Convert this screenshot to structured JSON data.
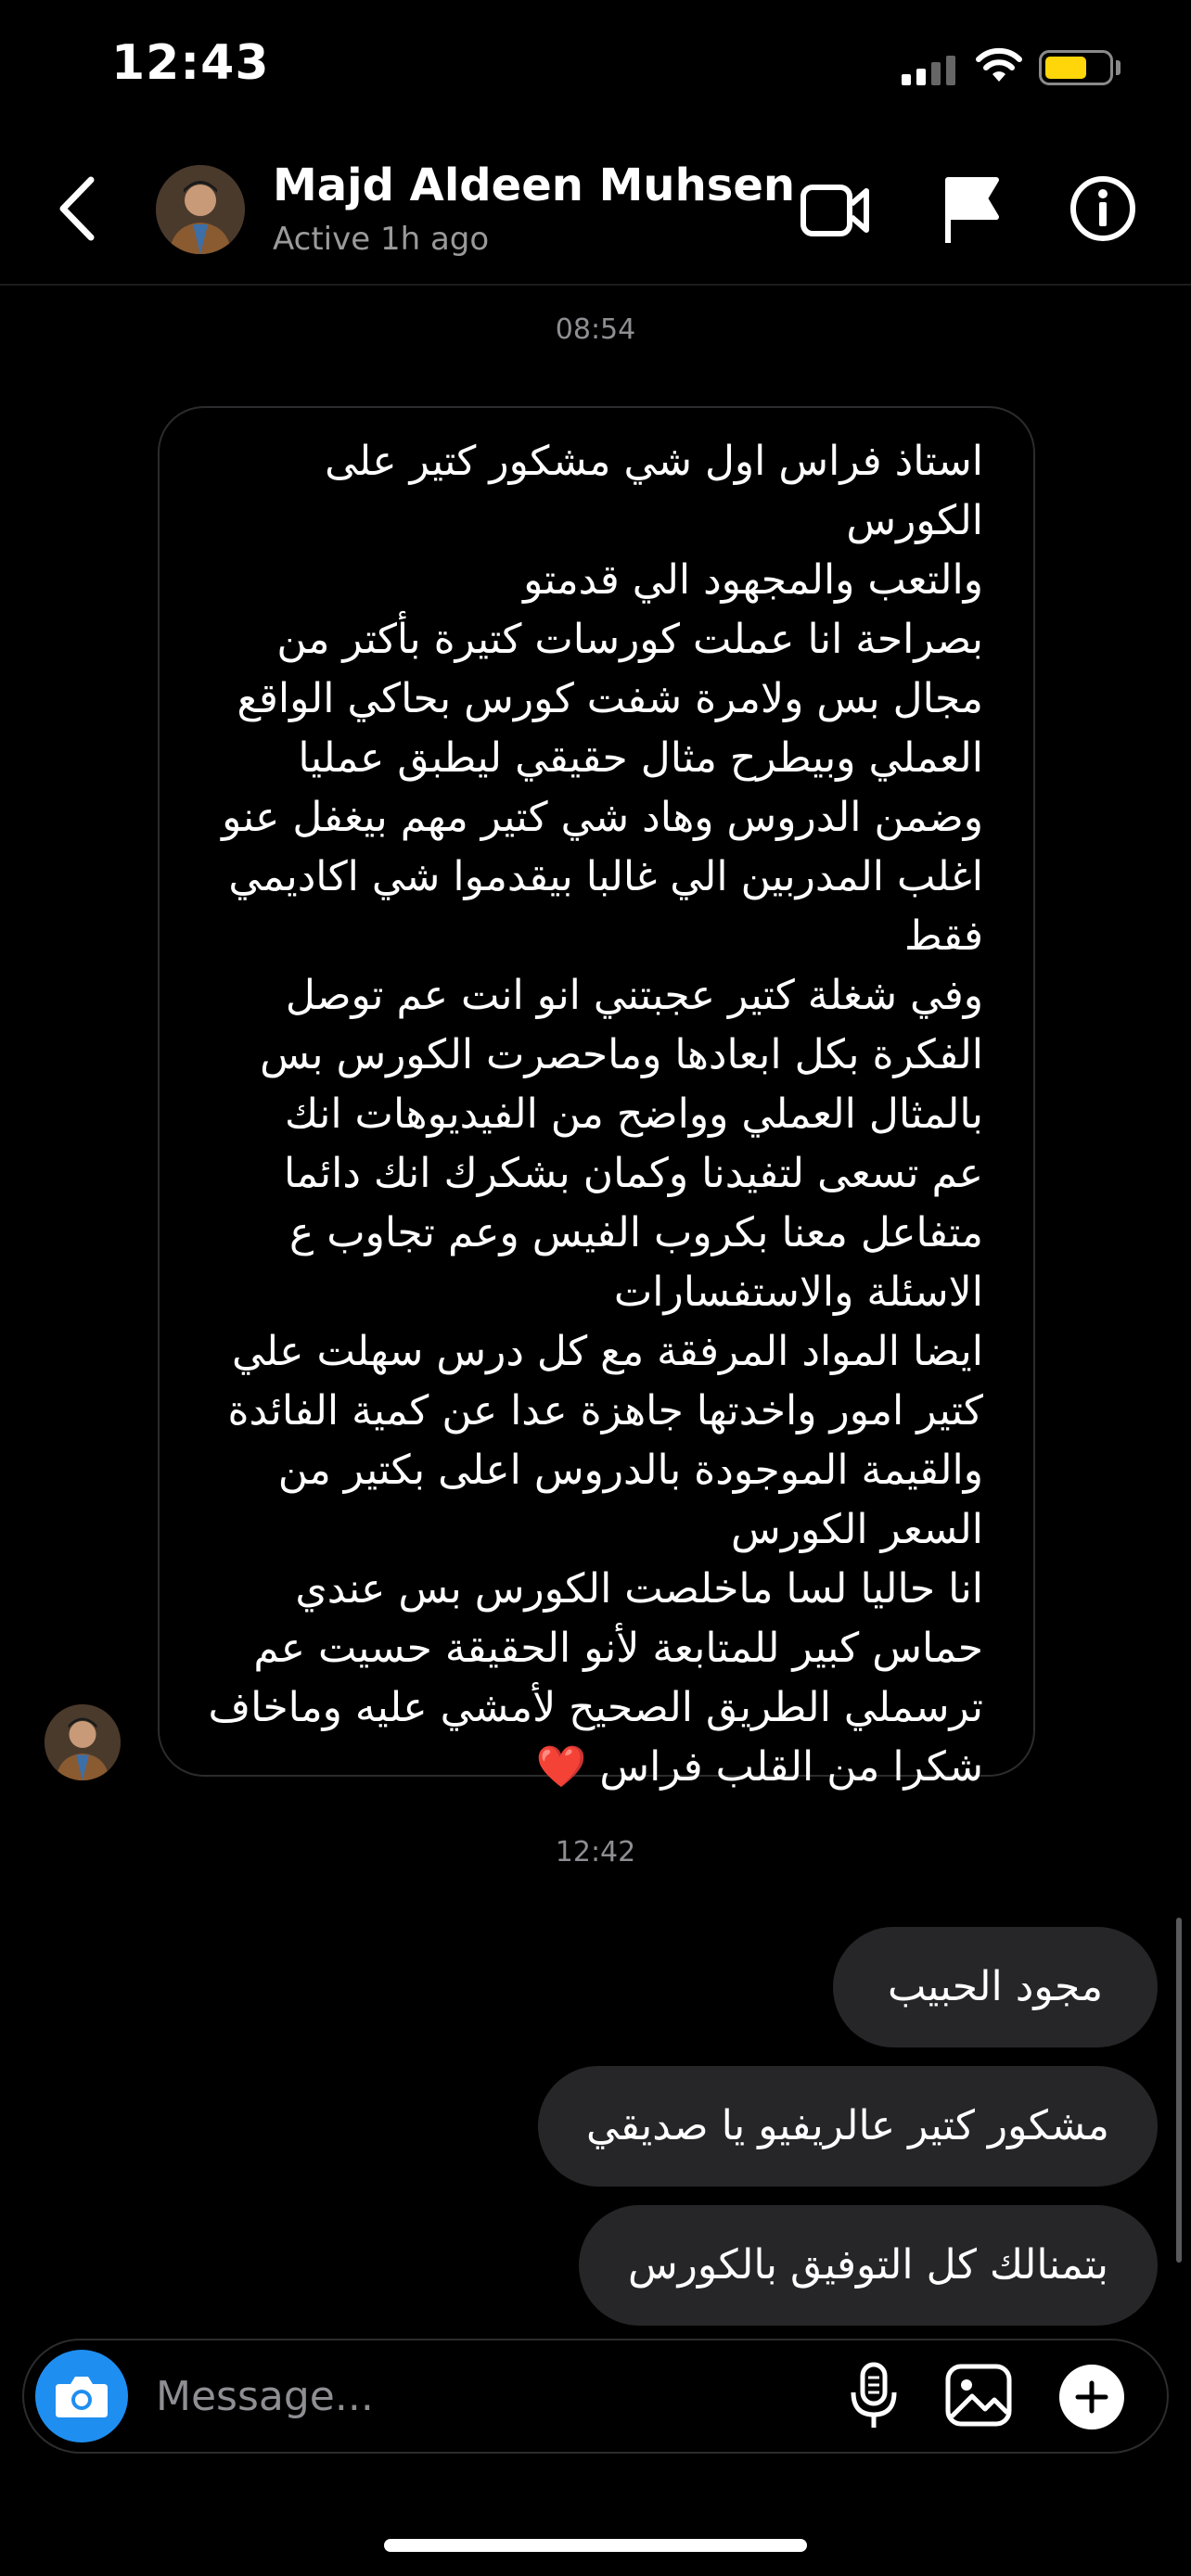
{
  "status_bar": {
    "time": "12:43"
  },
  "header": {
    "contact_name": "Majd Aldeen Muhsen",
    "contact_status": "Active 1h ago"
  },
  "thread": {
    "timestamp_1": "08:54",
    "received_message": "استاذ فراس اول شي مشكور كتير على الكورس\nوالتعب والمجهود الي قدمتو\nبصراحة انا عملت كورسات كتيرة بأكتر من\nمجال بس ولامرة شفت كورس بحاكي الواقع\nالعملي وبيطرح مثال حقيقي ليطبق عمليا\nوضمن الدروس وهاد شي كتير مهم بيغفل عنو\nاغلب المدربين الي غالبا بيقدموا شي اكاديمي\nفقط\nوفي شغلة كتير عجبتني انو انت عم توصل\nالفكرة بكل ابعادها وماحصرت الكورس بس\nبالمثال العملي وواضح من الفيديوهات انك\nعم تسعى لتفيدنا وكمان بشكرك انك دائما\nمتفاعل معنا بكروب الفيس وعم تجاوب ع\nالاسئلة والاستفسارات\nايضا المواد المرفقة مع كل درس سهلت علي\nكتير امور واخدتها جاهزة عدا عن كمية الفائدة\nوالقيمة الموجودة بالدروس اعلى بكتير من\nالسعر الكورس\nانا حاليا لسا ماخلصت الكورس بس عندي\nحماس كبير للمتابعة لأنو الحقيقة حسيت عم\nترسملي الطريق الصحيح لأمشي عليه وماخاف\nشكرا من القلب فراس",
    "received_emoji": "❤️",
    "timestamp_2": "12:42",
    "sent_messages": [
      "مجود الحبيب",
      "مشكور كتير عالريفيو يا صديقي",
      "بتمنالك كل التوفيق بالكورس"
    ]
  },
  "composer": {
    "placeholder": "Message..."
  },
  "colors": {
    "background": "#000000",
    "sent_bubble": "#262628",
    "received_border": "#2c2c2e",
    "camera_button": "#1f8ef1",
    "battery": "#ffd60a",
    "heart": "#e8232f",
    "muted_text": "#8e8e93"
  },
  "icons": [
    "back-chevron-icon",
    "video-call-icon",
    "flag-icon",
    "info-icon",
    "camera-icon",
    "microphone-icon",
    "gallery-icon",
    "plus-icon",
    "signal-icon",
    "wifi-icon",
    "battery-icon"
  ]
}
